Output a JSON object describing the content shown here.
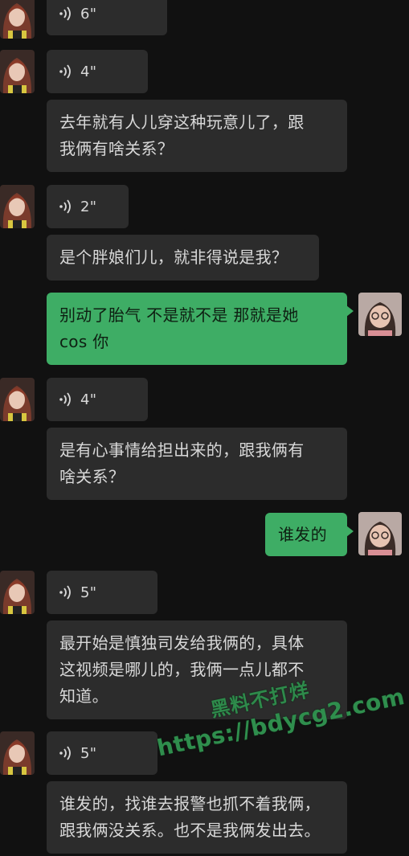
{
  "messages": [
    {
      "kind": "voice",
      "side": "in",
      "duration": "6\""
    },
    {
      "kind": "voice",
      "side": "in",
      "duration": "4\""
    },
    {
      "kind": "text",
      "side": "in",
      "lines": [
        "去年就有人儿穿这种玩意儿了，跟",
        "我俩有啥关系？"
      ]
    },
    {
      "kind": "voice",
      "side": "in",
      "duration": "2\""
    },
    {
      "kind": "text",
      "side": "in",
      "lines": [
        "是个胖娘们儿，就非得说是我？"
      ]
    },
    {
      "kind": "text",
      "side": "out",
      "lines": [
        "别动了胎气 不是就不是 那就是她",
        "cos 你"
      ]
    },
    {
      "kind": "voice",
      "side": "in",
      "duration": "4\""
    },
    {
      "kind": "text",
      "side": "in",
      "lines": [
        "是有心事情给担出来的，跟我俩有",
        "啥关系？"
      ]
    },
    {
      "kind": "text",
      "side": "out",
      "lines": [
        "谁发的"
      ]
    },
    {
      "kind": "voice",
      "side": "in",
      "duration": "5\""
    },
    {
      "kind": "text",
      "side": "in",
      "lines": [
        "最开始是慎独司发给我俩的，具体",
        "这视频是哪儿的，我俩一点儿都不",
        "知道。"
      ]
    },
    {
      "kind": "voice",
      "side": "in",
      "duration": "5\""
    },
    {
      "kind": "text",
      "side": "in",
      "lines": [
        "谁发的，找谁去报警也抓不着我俩，",
        "跟我俩没关系。也不是我俩发出去。"
      ]
    }
  ],
  "watermark": {
    "line1": "黑料不打烊",
    "line2": "https://bdycg2.com"
  },
  "colors": {
    "background": "#111111",
    "incoming_bubble": "#2c2c2c",
    "outgoing_bubble": "#3ead65",
    "watermark": "#2e8a4b"
  },
  "icons": {
    "voice": "voice-wave-icon",
    "avatar_left": "contact-avatar",
    "avatar_right": "self-avatar"
  }
}
